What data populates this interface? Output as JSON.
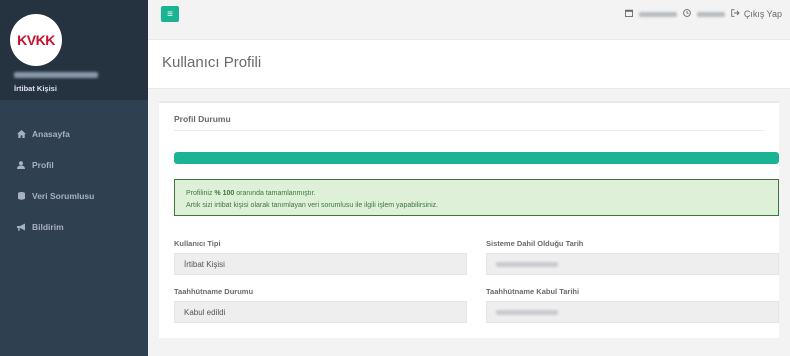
{
  "sidebar": {
    "logo_text": "KVKK",
    "user_role": "İrtibat Kişisi",
    "items": [
      {
        "label": "Anasayfa",
        "icon": "home-icon"
      },
      {
        "label": "Profil",
        "icon": "user-icon"
      },
      {
        "label": "Veri Sorumlusu",
        "icon": "database-icon"
      },
      {
        "label": "Bildirim",
        "icon": "bullhorn-icon"
      }
    ]
  },
  "topbar": {
    "logout_label": "Çıkış Yap"
  },
  "page": {
    "title": "Kullanıcı Profili"
  },
  "panel": {
    "title": "Profil Durumu",
    "progress_percent": 100,
    "alert_prefix": "Profiliniz",
    "alert_percent": "% 100",
    "alert_suffix": "oranında tamamlanmıştır.",
    "alert_line2": "Artık sizi irtibat kişisi olarak tanımlayan veri sorumlusu ile ilgili işlem yapabilirsiniz."
  },
  "fields": {
    "user_type_label": "Kullanıcı Tipi",
    "user_type_value": "İrtibat Kişisi",
    "join_date_label": "Sisteme Dahil Olduğu Tarih",
    "commitment_status_label": "Taahhütname Durumu",
    "commitment_status_value": "Kabul edildi",
    "commitment_date_label": "Taahhütname Kabul Tarihi"
  },
  "colors": {
    "accent": "#1ab394",
    "sidebar": "#2f4050",
    "alert_bg": "#dff0d8",
    "alert_text": "#3c763d"
  }
}
